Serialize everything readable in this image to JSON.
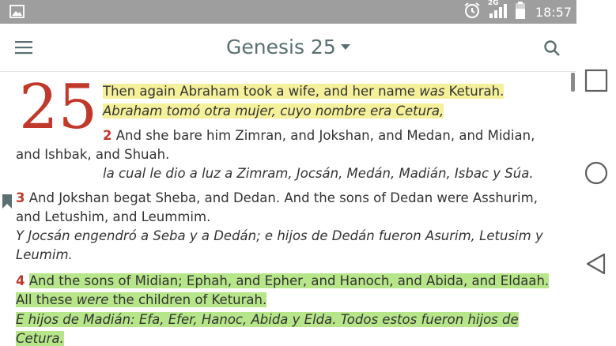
{
  "status": {
    "time": "18:57",
    "network": "2G"
  },
  "app": {
    "title": "Genesis 25"
  },
  "chapter": {
    "number": "25"
  },
  "verses": {
    "v1": {
      "en": {
        "a": "Then again Abraham took a wife, and her name ",
        "b": "was",
        "c": " Keturah."
      },
      "es": "Abraham tomó otra mujer, cuyo nombre era Cetura,"
    },
    "v2": {
      "num": "2",
      "en": {
        "a": " And she bare him Zimran, and Jokshan, and Medan, and Midian,",
        "b": "and Ishbak, and Shuah."
      },
      "es": "la cual le dio a luz a Zimram, Jocsán, Medán, Madián, Isbac y Súa."
    },
    "v3": {
      "num": "3",
      "en": {
        "a": " And Jokshan begat Sheba, and Dedan. And the sons of Dedan were Asshurim,",
        "b": "and Letushim, and Leummim."
      },
      "es": {
        "a": "Y Jocsán engendró a Seba y a Dedán; e hijos de Dedán fueron Asurim, Letusim y",
        "b": "Leumim."
      }
    },
    "v4": {
      "num": "4",
      "en": {
        "a": "And the sons of Midian; Ephah, and Epher, and Hanoch, and Abida, and Eldaah.",
        "b": "All these ",
        "c": "were",
        "d": " the children of Keturah."
      },
      "es": {
        "a": "E hijos de Madián: Efa, Efer, Hanoc, Abida y Elda. Todos estos fueron hijos de",
        "b": "Cetura."
      }
    }
  },
  "colors": {
    "verse_number": "#c0392b",
    "highlight_yellow": "#f5f09a",
    "highlight_green": "#b7e68a",
    "statusbar": "#9e9e9e",
    "title": "#5a6f72"
  }
}
